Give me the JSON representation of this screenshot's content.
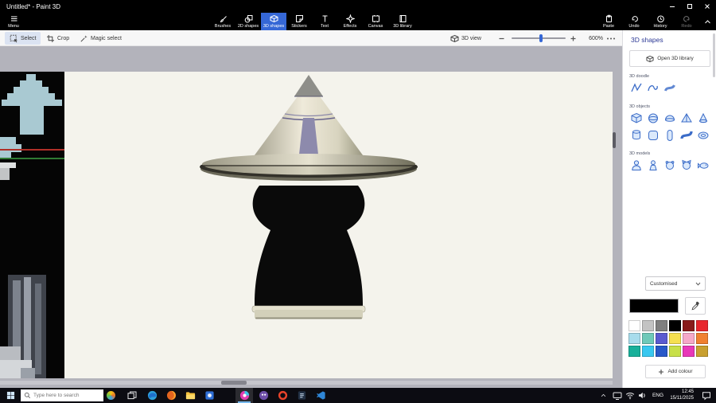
{
  "window": {
    "title": "Untitled* - Paint 3D"
  },
  "toolbar": {
    "menu": "Menu",
    "tools": [
      {
        "label": "Brushes",
        "icon": "brushes-icon",
        "active": false
      },
      {
        "label": "2D shapes",
        "icon": "2d-shapes-icon",
        "active": false
      },
      {
        "label": "3D shapes",
        "icon": "3d-shapes-icon",
        "active": true
      },
      {
        "label": "Stickers",
        "icon": "stickers-icon",
        "active": false
      },
      {
        "label": "Text",
        "icon": "text-icon",
        "active": false
      },
      {
        "label": "Effects",
        "icon": "effects-icon",
        "active": false
      },
      {
        "label": "Canvas",
        "icon": "canvas-icon",
        "active": false
      },
      {
        "label": "3D library",
        "icon": "3d-library-icon",
        "active": false
      }
    ],
    "paste": "Paste",
    "undo": "Undo",
    "history": "History",
    "redo": "Redo"
  },
  "subtoolbar": {
    "select": "Select",
    "crop": "Crop",
    "magic_select": "Magic select",
    "view_3d": "3D view",
    "zoom_level": "600%"
  },
  "panel": {
    "title": "3D shapes",
    "open_library": "Open 3D library",
    "doodle_label": "3D doodle",
    "objects_label": "3D objects",
    "models_label": "3D models",
    "customised": "Customised",
    "add_colour": "Add colour",
    "selected_colour": "#000000",
    "doodle_icons": [
      "sharp-edge-doodle-icon",
      "soft-edge-doodle-icon",
      "tube-brush-doodle-icon"
    ],
    "object_icons": [
      "cube-icon",
      "sphere-icon",
      "hemisphere-icon",
      "pyramid-icon",
      "cone-icon",
      "cylinder-icon",
      "rounded-cube-icon",
      "capsule-icon",
      "curved-tube-icon",
      "doughnut-icon"
    ],
    "model_icons": [
      "man-icon",
      "woman-icon",
      "dog-icon",
      "cat-icon",
      "fish-icon"
    ],
    "palette": [
      "#ffffff",
      "#c3c3c3",
      "#7f7f7f",
      "#000000",
      "#891b1b",
      "#e8262d",
      "#a8dcec",
      "#6fc9b9",
      "#5a5ad0",
      "#f5e050",
      "#f5a8c8",
      "#f08030",
      "#18b09a",
      "#38c8f0",
      "#2858c8",
      "#c8e048",
      "#e838b8",
      "#c8a030"
    ]
  },
  "canvas": {
    "object_colors": {
      "tip": "#8e8e89",
      "cone": "#efeada",
      "stripe": "#8d8aac",
      "saucer": "#e6e2d0",
      "body": "#0a0a0a",
      "base": "#d3d0ba"
    }
  },
  "taskbar": {
    "search_placeholder": "Type here to search",
    "language": "ENG",
    "time": "12:45",
    "date": "15/11/2025",
    "apps": [
      "task-view",
      "edge",
      "firefox",
      "file-explorer",
      "photos",
      "paint-3d",
      "gimp",
      "opera",
      "notepad",
      "vscode"
    ],
    "active_app": "paint-3d"
  }
}
